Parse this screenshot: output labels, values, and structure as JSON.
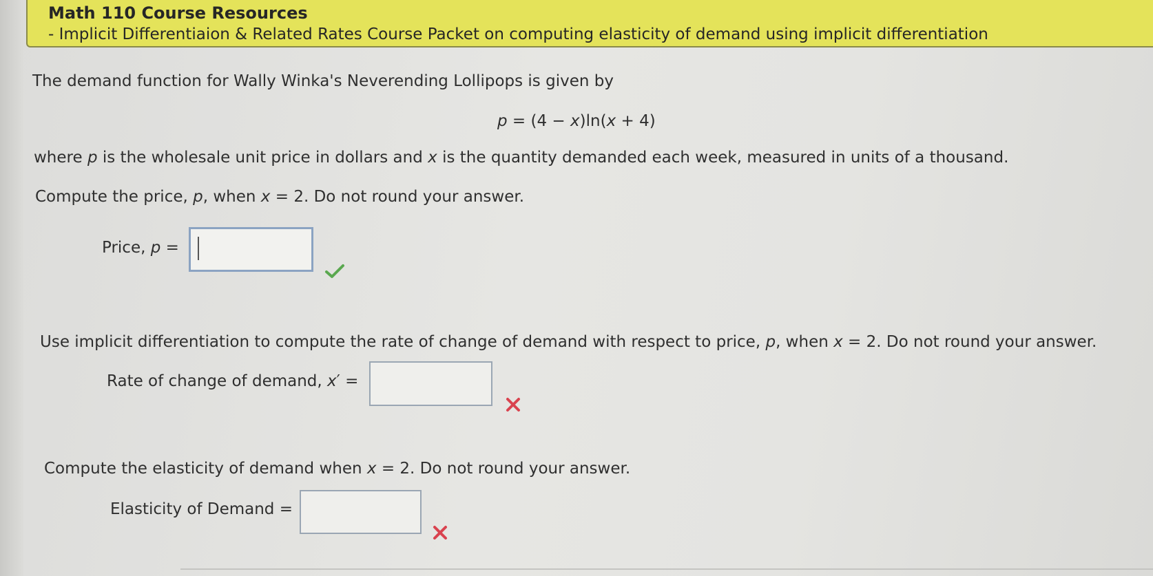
{
  "header": {
    "title": "Math 110 Course Resources",
    "subtitle": "- Implicit Differentiaion & Related Rates Course Packet on computing elasticity of demand using implicit differentiation"
  },
  "problem": {
    "intro": "The demand function for Wally Winka's Neverending Lollipops is given by",
    "formula_p": "p",
    "formula_eq": " = (4 − ",
    "formula_x1": "x",
    "formula_mid": ")ln(",
    "formula_x2": "x",
    "formula_end": " + 4)",
    "where_1": "where ",
    "where_p": "p",
    "where_2": " is the wholesale unit price in dollars and ",
    "where_x": "x",
    "where_3": " is the quantity demanded each week, measured in units of a thousand."
  },
  "part1": {
    "q_1": "Compute the price, ",
    "q_p": "p",
    "q_2": ", when ",
    "q_x": "x",
    "q_3": " = 2. Do not round your answer.",
    "label_1": "Price, ",
    "label_p": "p",
    "label_2": " =",
    "value": "",
    "status": "correct"
  },
  "part2": {
    "q_1": "Use implicit differentiation to compute the rate of change of demand with respect to price, ",
    "q_p": "p",
    "q_2": ", when ",
    "q_x": "x",
    "q_3": " = 2. Do not round your answer.",
    "label_1": "Rate of change of demand, ",
    "label_x": "x",
    "label_2": "′ =",
    "value": "",
    "status": "incorrect"
  },
  "part3": {
    "q_1": "Compute the elasticity of demand when ",
    "q_x": "x",
    "q_2": " = 2. Do not round your answer.",
    "label": "Elasticity of Demand =",
    "value": "",
    "status": "incorrect"
  },
  "colors": {
    "banner": "#e4e35a",
    "correct": "#5aa84f",
    "incorrect": "#d9434f"
  },
  "icons": {
    "correct": "check-icon",
    "incorrect": "x-mark-icon"
  }
}
